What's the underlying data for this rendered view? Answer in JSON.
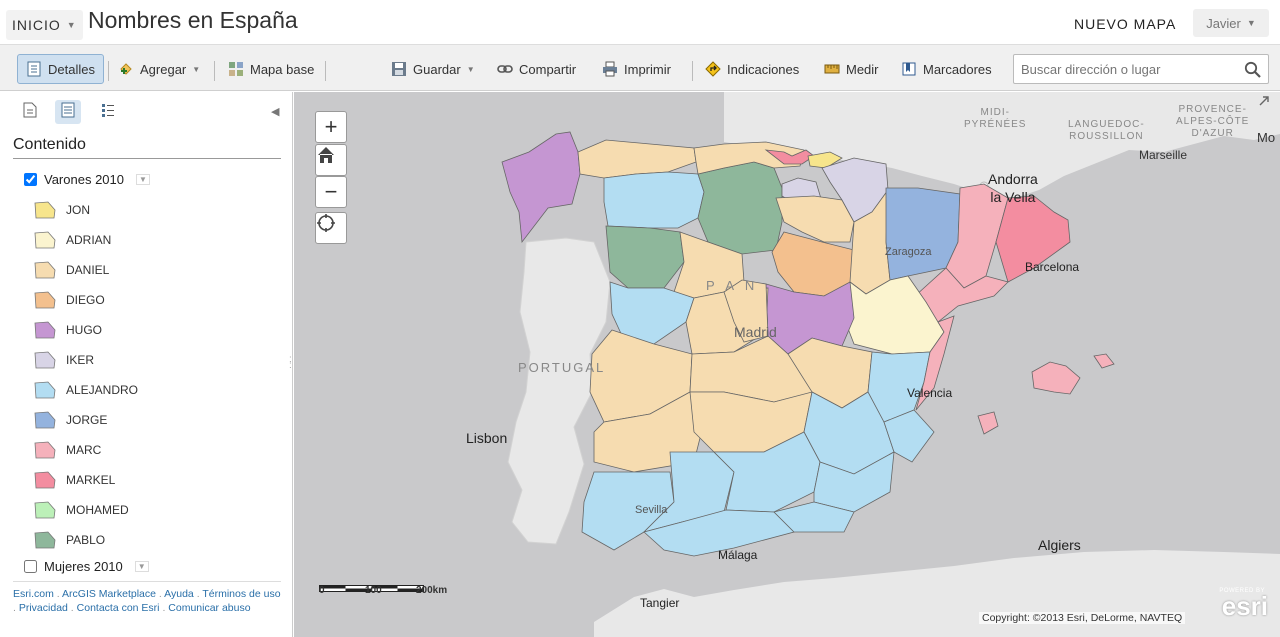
{
  "header": {
    "home_label": "INICIO",
    "title": "Nombres en España",
    "new_map_label": "NUEVO MAPA",
    "user_label": "Javier"
  },
  "toolbar": {
    "details_label": "Detalles",
    "add_label": "Agregar",
    "basemap_label": "Mapa base",
    "save_label": "Guardar",
    "share_label": "Compartir",
    "print_label": "Imprimir",
    "directions_label": "Indicaciones",
    "measure_label": "Medir",
    "bookmarks_label": "Marcadores",
    "search_placeholder": "Buscar dirección o lugar"
  },
  "panel": {
    "contents_title": "Contenido",
    "layers": [
      {
        "name": "Varones 2010",
        "checked": true,
        "legend": [
          {
            "label": "JON",
            "color": "#f7e58c"
          },
          {
            "label": "ADRIAN",
            "color": "#fbf4cf"
          },
          {
            "label": "DANIEL",
            "color": "#f6dcb0"
          },
          {
            "label": "DIEGO",
            "color": "#f3c08e"
          },
          {
            "label": "HUGO",
            "color": "#c596d2"
          },
          {
            "label": "IKER",
            "color": "#d8d4e6"
          },
          {
            "label": "ALEJANDRO",
            "color": "#b3ddf2"
          },
          {
            "label": "JORGE",
            "color": "#94b3de"
          },
          {
            "label": "MARC",
            "color": "#f5b1bb"
          },
          {
            "label": "MARKEL",
            "color": "#f38da0"
          },
          {
            "label": "MOHAMED",
            "color": "#bcf0b8"
          },
          {
            "label": "PABLO",
            "color": "#8eb79b"
          }
        ]
      },
      {
        "name": "Mujeres 2010",
        "checked": false
      }
    ],
    "footer_links": [
      "Esri.com",
      "ArcGIS Marketplace",
      "Ayuda",
      "Términos de uso",
      "Privacidad",
      "Contacta con Esri",
      "Comunicar abuso"
    ]
  },
  "map": {
    "zoom_in": "+",
    "zoom_out": "−",
    "scale_labels": [
      "0",
      "100",
      "200km"
    ],
    "copyright": "Copyright: ©2013 Esri, DeLorme, NAVTEQ",
    "esri_powered": "POWERED BY",
    "esri_name": "esri",
    "place_labels": {
      "midi": "MIDI-\nPYRÉNÉES",
      "languedoc": "LANGUEDOC-\nROUSSILLON",
      "provence": "PROVENCE-\nALPES-CÔTE\nD'AZUR",
      "marseille": "Marseille",
      "andorra": "Andorra\nla Vella",
      "zaragoza": "Zaragoza",
      "barcelona": "Barcelona",
      "madrid": "Madrid",
      "portugal": "PORTUGAL",
      "lisbon": "Lisbon",
      "valencia": "Valencia",
      "sevilla": "Sevilla",
      "malaga": "Málaga",
      "tangier": "Tangier",
      "algiers": "Algiers",
      "mo": "Mo",
      "spain_e": "P A N"
    }
  }
}
